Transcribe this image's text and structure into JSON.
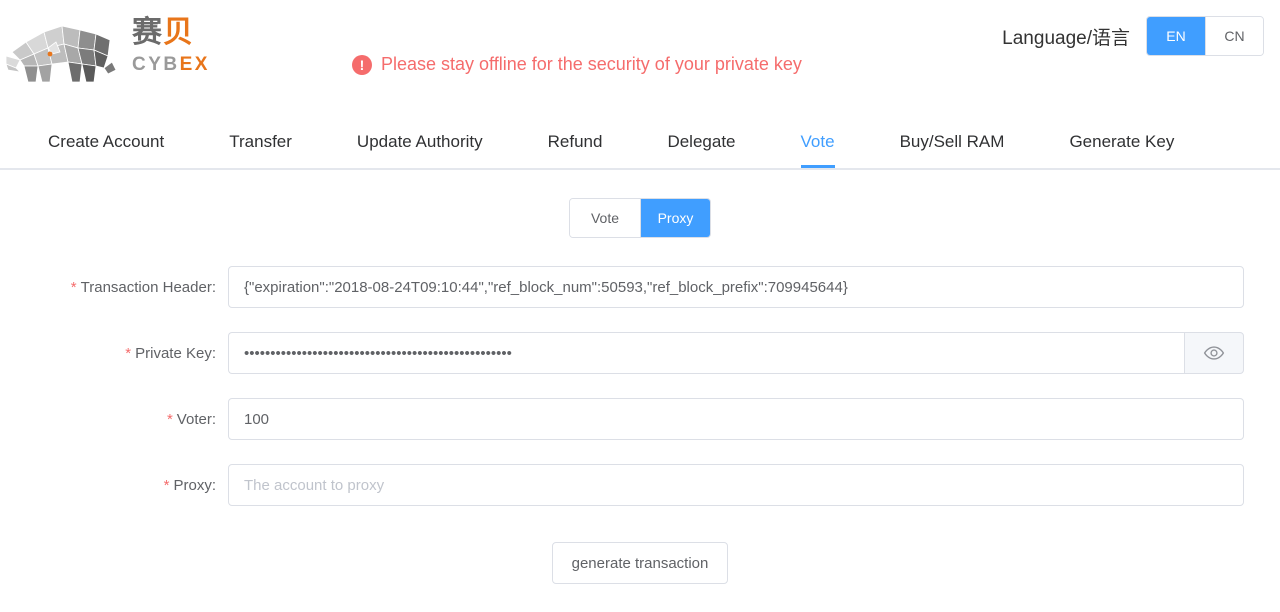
{
  "header": {
    "logo": {
      "cn_gray": "赛",
      "cn_orange": "贝",
      "en_gray": "CYB",
      "en_orange": "EX",
      "icon": "rhino-logo"
    },
    "warning": {
      "icon": "exclamation-circle-icon",
      "text": "Please stay offline for the security of your private key",
      "color": "#f56c6c"
    },
    "language": {
      "label": "Language/语言",
      "options": [
        {
          "label": "EN",
          "active": true
        },
        {
          "label": "CN",
          "active": false
        }
      ]
    }
  },
  "nav": {
    "items": [
      {
        "label": "Create Account",
        "active": false
      },
      {
        "label": "Transfer",
        "active": false
      },
      {
        "label": "Update Authority",
        "active": false
      },
      {
        "label": "Refund",
        "active": false
      },
      {
        "label": "Delegate",
        "active": false
      },
      {
        "label": "Vote",
        "active": true
      },
      {
        "label": "Buy/Sell RAM",
        "active": false
      },
      {
        "label": "Generate Key",
        "active": false
      }
    ],
    "accent_color": "#409eff"
  },
  "main": {
    "mode_toggle": {
      "options": [
        {
          "label": "Vote",
          "active": false
        },
        {
          "label": "Proxy",
          "active": true
        }
      ]
    },
    "form": {
      "transaction_header": {
        "label": "Transaction Header:",
        "required_mark": "*",
        "value": "{\"expiration\":\"2018-08-24T09:10:44\",\"ref_block_num\":50593,\"ref_block_prefix\":709945644}",
        "placeholder": ""
      },
      "private_key": {
        "label": "Private Key:",
        "required_mark": "*",
        "value": "•••••••••••••••••••••••••••••••••••••••••••••••••••",
        "placeholder": "",
        "append_icon": "eye-icon"
      },
      "voter": {
        "label": "Voter:",
        "required_mark": "*",
        "value": "100",
        "placeholder": ""
      },
      "proxy": {
        "label": "Proxy:",
        "required_mark": "*",
        "value": "",
        "placeholder": "The account to proxy"
      }
    },
    "submit": {
      "label": "generate transaction"
    }
  }
}
